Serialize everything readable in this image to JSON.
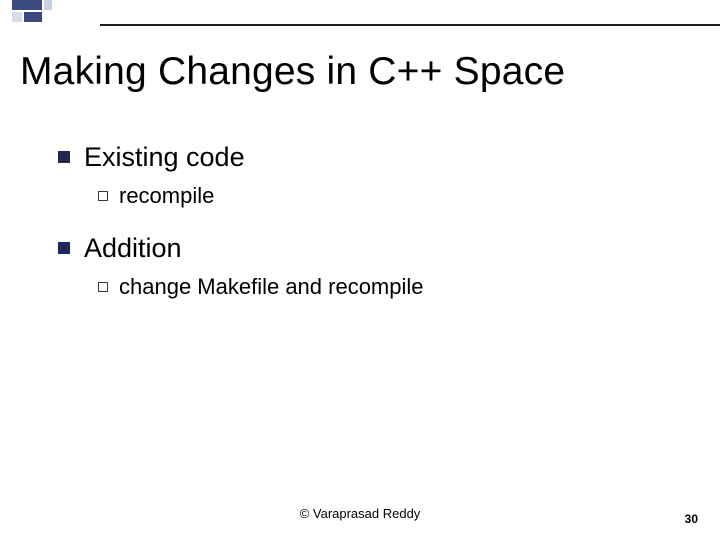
{
  "slide": {
    "title": "Making Changes in C++ Space"
  },
  "bullets": [
    {
      "label": "Existing code",
      "sub": [
        {
          "label": "recompile"
        }
      ]
    },
    {
      "label": "Addition",
      "sub": [
        {
          "label": "change Makefile and recompile"
        }
      ]
    }
  ],
  "footer": {
    "copyright": "©  Varaprasad Reddy",
    "page_number": "30"
  }
}
